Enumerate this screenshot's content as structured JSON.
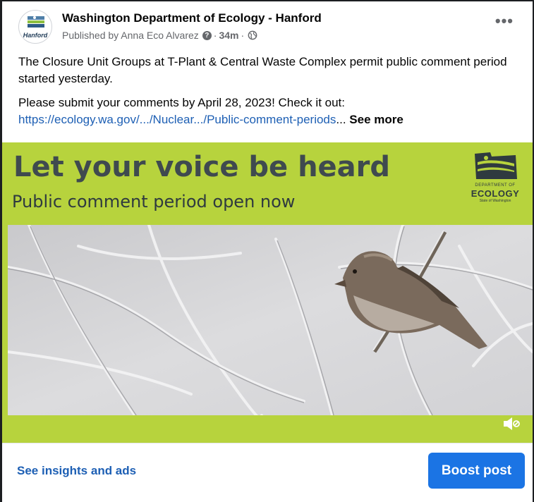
{
  "header": {
    "page_name": "Washington Department of Ecology - Hanford",
    "avatar_text": "Hanford",
    "published_prefix": "Published by Anna Eco Alvarez",
    "question_glyph": "?",
    "separator": "·",
    "time": "34m",
    "more_label": "•••"
  },
  "post": {
    "paragraph1": "The Closure Unit Groups at T-Plant & Central Waste Complex permit public comment period started yesterday.",
    "paragraph2_text": "Please submit your comments by April 28, 2023! Check it out:",
    "link_text": "https://ecology.wa.gov/.../Nuclear.../Public-comment-periods",
    "ellipsis": "...",
    "see_more": "See more"
  },
  "media": {
    "banner_title": "Let your voice be heard",
    "banner_subtitle": "Public comment period open now",
    "logo_dept": "DEPARTMENT OF",
    "logo_name": "ECOLOGY",
    "logo_state": "State of Washington",
    "background_color": "#b7d33d"
  },
  "footer": {
    "insights_label": "See insights and ads",
    "boost_label": "Boost post"
  },
  "colors": {
    "link": "#1d5fb4",
    "button": "#1b74e4",
    "banner_green": "#b7d33d",
    "banner_text": "#3f4a4f"
  }
}
